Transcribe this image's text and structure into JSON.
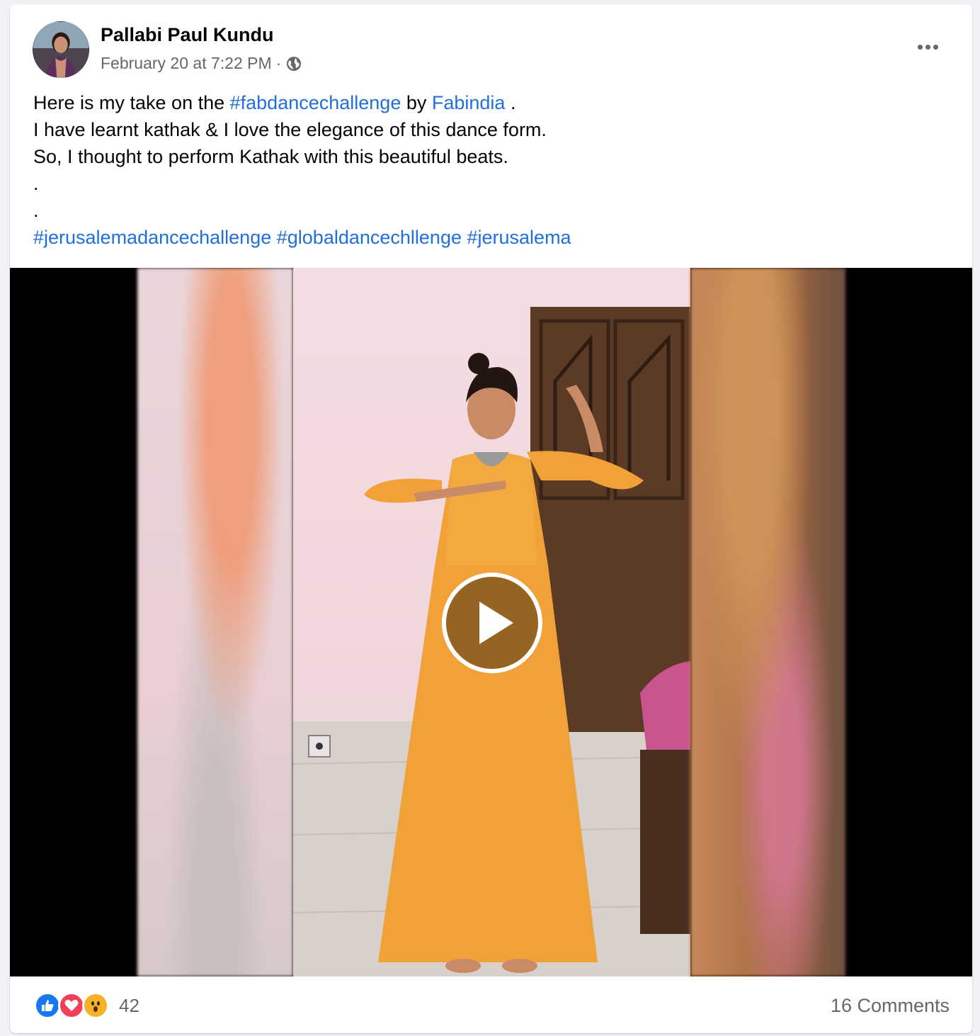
{
  "post": {
    "author": "Pallabi Paul Kundu",
    "timestamp": "February 20 at 7:22 PM",
    "separator": "·",
    "privacy_icon": "globe-icon",
    "more_icon": "more-options-icon",
    "text": {
      "line1_prefix": "Here is my take on the ",
      "line1_hashtag": "#fabdancechallenge",
      "line1_mid": " by ",
      "line1_page": "Fabindia",
      "line1_suffix": " .",
      "line2": "I have learnt kathak & I love the elegance of this dance form.",
      "line3": "So, I thought to perform Kathak with this beautiful beats.",
      "line4": ".",
      "line5": ".",
      "hashtags": [
        "#jerusalemadancechallenge",
        "#globaldancechllenge",
        "#jerusalema"
      ]
    }
  },
  "video": {
    "play_icon": "play-icon"
  },
  "footer": {
    "reactions": [
      "like-icon",
      "love-icon",
      "wow-icon"
    ],
    "reaction_count": "42",
    "comments": "16 Comments"
  },
  "colors": {
    "link": "#216fdb",
    "secondary_text": "#65676b",
    "like": "#1877f2",
    "love": "#f33e58",
    "wow": "#f7b125"
  }
}
